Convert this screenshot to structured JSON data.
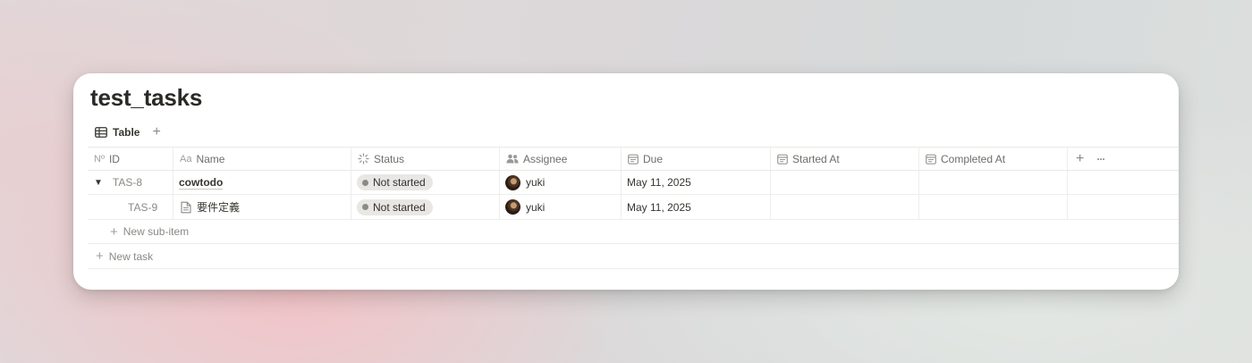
{
  "title": "test_tasks",
  "view": {
    "tab_label": "Table",
    "add_label": "+"
  },
  "columns": {
    "id": "ID",
    "id_icon": "Nº",
    "name": "Name",
    "name_icon": "Aa",
    "status": "Status",
    "assignee": "Assignee",
    "due": "Due",
    "started": "Started At",
    "completed": "Completed At",
    "add": "+",
    "more": "···"
  },
  "rows": [
    {
      "id": "TAS-8",
      "name": "cowtodo",
      "status": "Not started",
      "assignee": "yuki",
      "due": "May 11, 2025",
      "started": "",
      "completed": ""
    },
    {
      "id": "TAS-9",
      "name": "要件定義",
      "status": "Not started",
      "assignee": "yuki",
      "due": "May 11, 2025",
      "started": "",
      "completed": ""
    }
  ],
  "add_subitem": {
    "plus": "+",
    "label": "New sub-item"
  },
  "add_task": {
    "plus": "+",
    "label": "New task"
  },
  "colors": {
    "status_pill_bg": "#e8e7e4",
    "status_dot": "#8d8b86",
    "text": "#37352f"
  }
}
